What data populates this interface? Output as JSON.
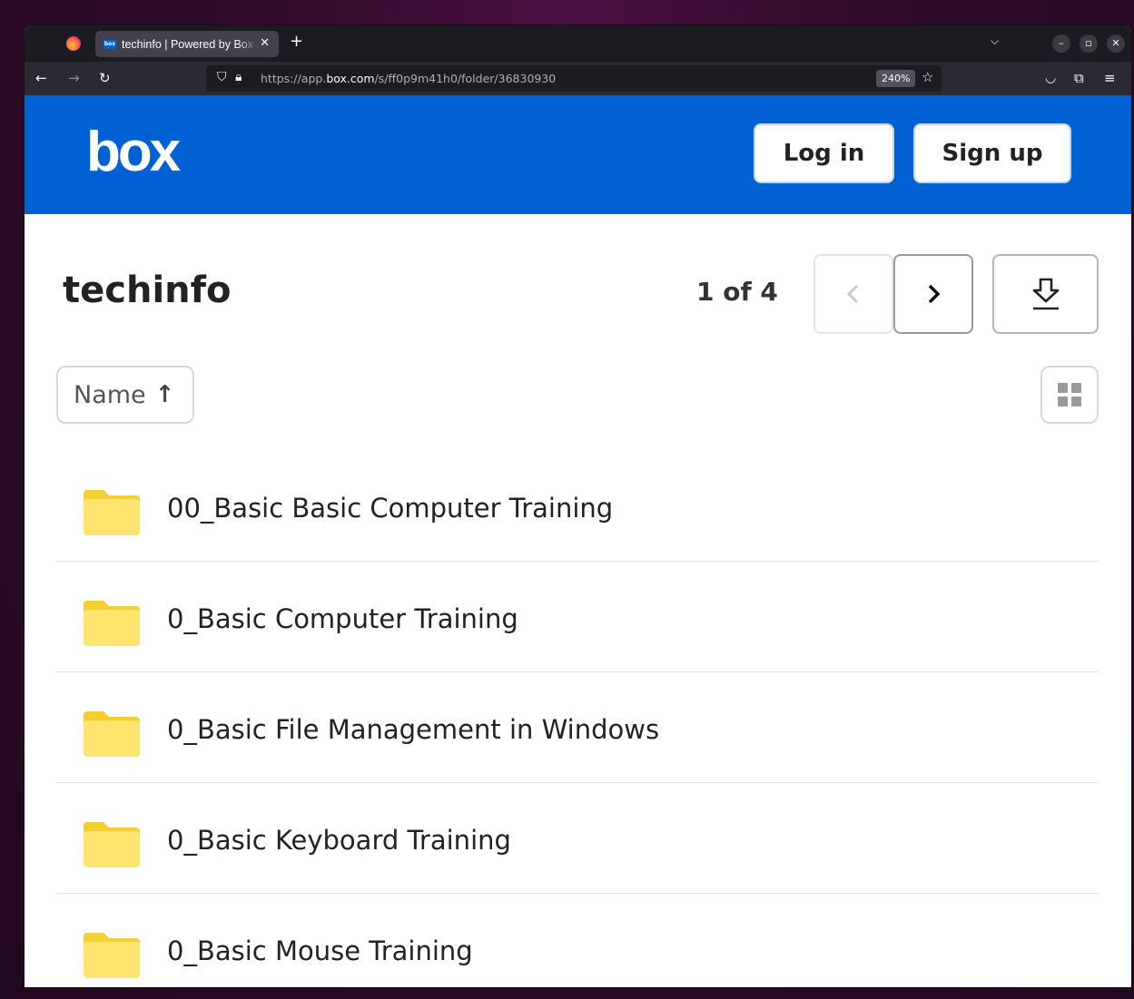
{
  "browser": {
    "tab_title": "techinfo | Powered by Box",
    "favicon_text": "box",
    "url_prefix": "https://app.",
    "url_domain": "box.com",
    "url_path": "/s/ff0p9m41h0/folder/36830930",
    "zoom": "240%"
  },
  "header": {
    "logo": "box",
    "login_label": "Log in",
    "signup_label": "Sign up"
  },
  "folder": {
    "title": "techinfo",
    "pager": "1 of 4"
  },
  "toolbar": {
    "sort_label": "Name",
    "sort_direction": "ascending"
  },
  "items": [
    {
      "name": "00_Basic Basic Computer Training",
      "type": "folder"
    },
    {
      "name": "0_Basic Computer Training",
      "type": "folder"
    },
    {
      "name": "0_Basic File Management in Windows",
      "type": "folder"
    },
    {
      "name": "0_Basic Keyboard Training",
      "type": "folder"
    },
    {
      "name": "0_Basic Mouse Training",
      "type": "folder"
    }
  ],
  "colors": {
    "brand": "#0061d5",
    "folder": "#ffe46d",
    "folder_tab": "#f5cf2f"
  },
  "icons": {
    "firefox": "firefox-logo-icon",
    "back": "back-arrow-icon",
    "forward": "forward-arrow-icon",
    "reload": "reload-icon",
    "shield": "tracking-shield-icon",
    "lock": "lock-icon",
    "bookmark": "bookmark-star-icon",
    "pocket": "pocket-icon",
    "extensions": "extensions-icon",
    "menu": "hamburger-menu-icon",
    "prev": "chevron-left-icon",
    "next": "chevron-right-icon",
    "download": "download-icon",
    "sort": "arrow-up-icon",
    "grid": "grid-view-icon",
    "folder": "folder-icon"
  }
}
